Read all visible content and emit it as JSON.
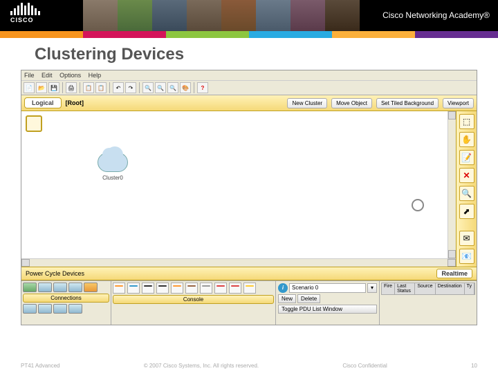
{
  "banner": {
    "logo_text": "CISCO",
    "academy": "Cisco Networking Academy®"
  },
  "slide": {
    "title": "Clustering Devices"
  },
  "menu": {
    "file": "File",
    "edit": "Edit",
    "options": "Options",
    "help": "Help"
  },
  "toolbar2": {
    "logical_tab": "Logical",
    "root": "[Root]",
    "new_cluster": "New Cluster",
    "move_object": "Move Object",
    "set_bg": "Set Tiled Background",
    "viewport": "Viewport"
  },
  "canvas": {
    "cluster0": "Cluster0"
  },
  "rtools": {
    "select": "select",
    "hand": "hand",
    "note": "note",
    "delete": "×",
    "zoom": "zoom",
    "shape": "shape"
  },
  "pcd": {
    "label": "Power Cycle Devices",
    "realtime": "Realtime"
  },
  "devices": {
    "connections": "Connections",
    "console": "Console"
  },
  "scenario": {
    "field": "Scenario 0",
    "new": "New",
    "delete": "Delete",
    "toggle": "Toggle PDU List Window"
  },
  "pdu": {
    "fire": "Fire",
    "last_status": "Last Status",
    "source": "Source",
    "destination": "Destination",
    "type": "Ty"
  },
  "footer": {
    "left": "PT41 Advanced",
    "center": "© 2007 Cisco Systems, Inc. All rights reserved.",
    "right": "Cisco Confidential",
    "page": "10"
  }
}
